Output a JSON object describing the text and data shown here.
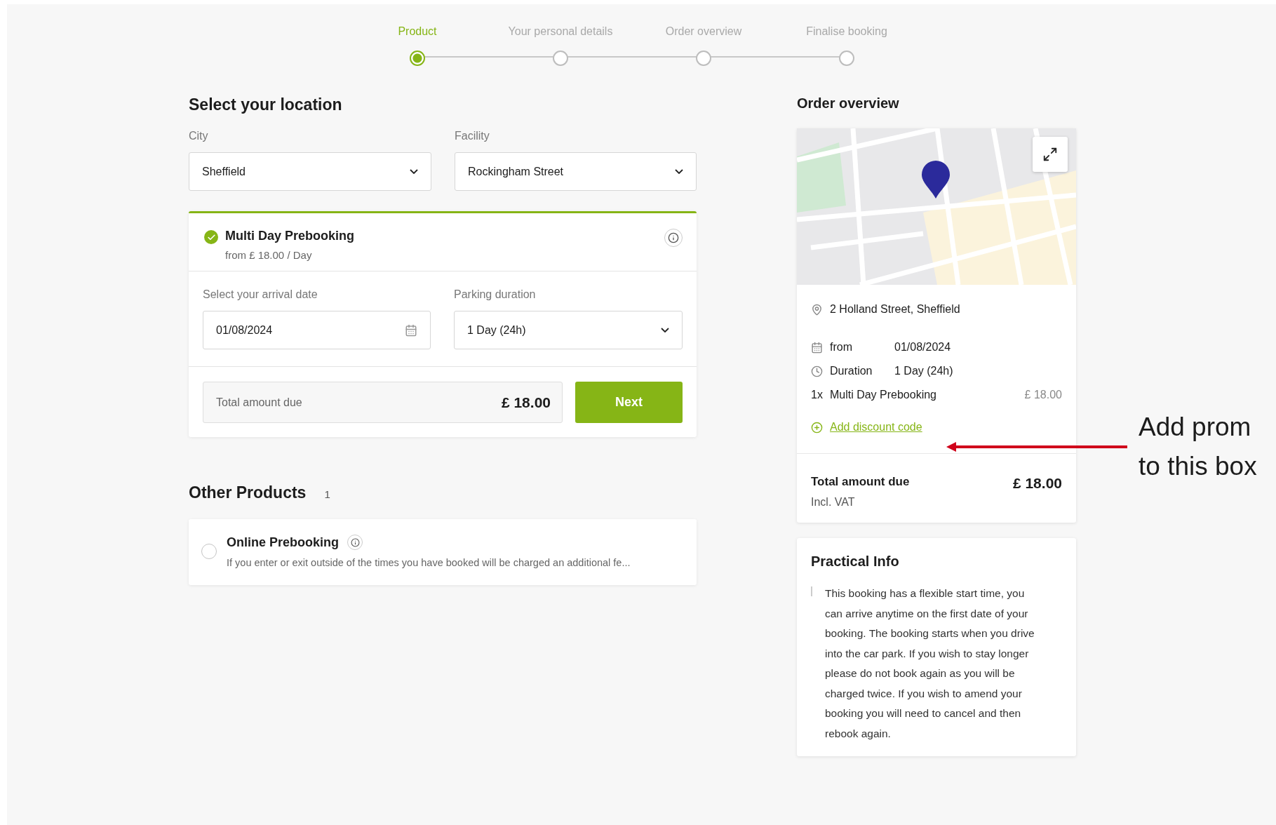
{
  "stepper": {
    "steps": [
      {
        "label": "Product",
        "selected": true
      },
      {
        "label": "Your personal details",
        "selected": false
      },
      {
        "label": "Order overview",
        "selected": false
      },
      {
        "label": "Finalise booking",
        "selected": false
      }
    ]
  },
  "location": {
    "title": "Select your location",
    "fields": [
      {
        "label": "City",
        "value": "Sheffield"
      },
      {
        "label": "Facility",
        "value": "Rockingham Street"
      }
    ]
  },
  "product": {
    "title": "Multi Day Prebooking",
    "price": "from £ 18.00 / Day",
    "selected": true,
    "date_label": "Select your arrival date",
    "date_value": "01/08/2024",
    "duration_label": "Parking duration",
    "duration_value": "1 Day (24h)",
    "total_label": "Total amount due",
    "total_value": "£ 18.00",
    "next_button": "Next"
  },
  "other_products": {
    "title": "Other Products",
    "count": "1",
    "items": [
      {
        "title": "Online Prebooking",
        "description": "If you enter or exit outside of the times you have booked will be charged an additional fe...",
        "selected": false
      }
    ]
  },
  "order_overview": {
    "title": "Order overview",
    "address": "2 Holland Street, Sheffield",
    "details": [
      {
        "kind": "date",
        "label": "from",
        "value": "01/08/2024"
      },
      {
        "kind": "duration",
        "label": "Duration",
        "value": "1 Day (24h)"
      }
    ],
    "line_item": {
      "quantity": "1x",
      "name": "Multi Day Prebooking",
      "price": "£ 18.00"
    },
    "discount_link": "Add discount code",
    "total_label": "Total amount due",
    "total_note": "Incl. VAT",
    "total_value": "£ 18.00"
  },
  "practical_info": {
    "title": "Practical Info",
    "text": "This booking has a flexible start time, you can arrive anytime on the first date of your booking. The booking starts when you drive into the car park. If you wish to stay longer please do not book again as you will be charged twice. If you wish to amend your booking you will need to cancel and then rebook again."
  },
  "annotation": {
    "lines": [
      "Add prom",
      "to this box"
    ]
  }
}
